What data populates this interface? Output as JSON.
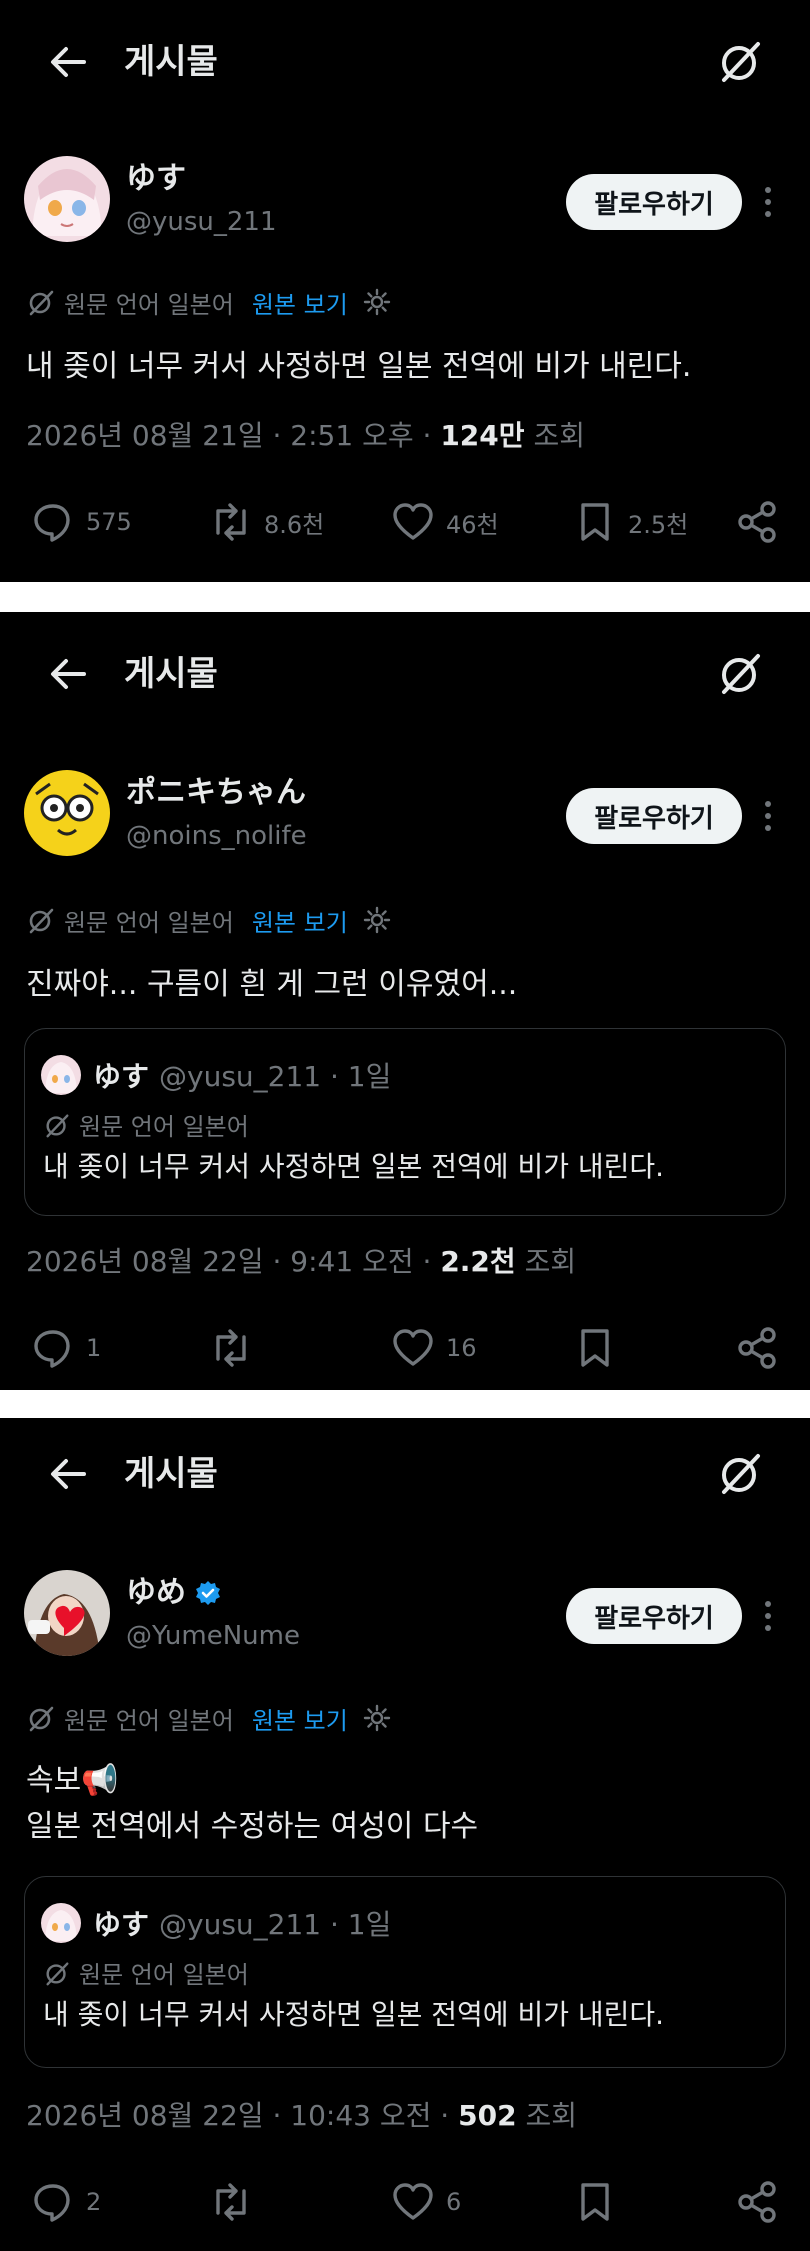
{
  "colors": {
    "background": "#000000",
    "text": "#e7e9ea",
    "muted": "#71767b",
    "link": "#1d9bf0",
    "verified": "#1d9bf0"
  },
  "icons": {
    "back": "arrow-left-icon",
    "grok": "grok-icon",
    "more": "more-vertical-icon",
    "translate": "grok-small-icon",
    "settings": "gear-icon",
    "reply": "reply-icon",
    "repost": "repost-icon",
    "like": "heart-icon",
    "bookmark": "bookmark-icon",
    "share": "share-icon",
    "verified": "verified-badge-icon",
    "megaphone": "megaphone-emoji"
  },
  "posts": [
    {
      "header_title": "게시물",
      "author_name": "ゆす",
      "author_handle": "@yusu_211",
      "follow_label": "팔로우하기",
      "translate_label": "원문 언어 일본어",
      "show_original": "원본 보기",
      "text": "내 좆이 너무 커서 사정하면 일본 전역에 비가 내린다.",
      "timestamp": "2026년 08월 21일 · 2:51 오후 ·",
      "views_count": "124만",
      "views_label": "조회",
      "replies": "575",
      "reposts": "8.6천",
      "likes": "46천",
      "bookmarks": "2.5천"
    },
    {
      "header_title": "게시물",
      "author_name": "ポニキちゃん",
      "author_handle": "@noins_nolife",
      "follow_label": "팔로우하기",
      "translate_label": "원문 언어 일본어",
      "show_original": "원본 보기",
      "text": "진짜야... 구름이 흰 게 그런 이유였어...",
      "quote": {
        "name": "ゆす",
        "handle_time": "@yusu_211 · 1일",
        "translate_label": "원문 언어 일본어",
        "text": "내 좆이 너무 커서 사정하면 일본 전역에 비가 내린다."
      },
      "timestamp": "2026년 08월 22일 · 9:41 오전 ·",
      "views_count": "2.2천",
      "views_label": "조회",
      "replies": "1",
      "reposts": "",
      "likes": "16",
      "bookmarks": ""
    },
    {
      "header_title": "게시물",
      "author_name": "ゆめ",
      "author_handle": "@YumeNume",
      "follow_label": "팔로우하기",
      "translate_label": "원문 언어 일본어",
      "show_original": "원본 보기",
      "text_line1": "속보📢",
      "text_line2": "일본 전역에서 수정하는 여성이 다수",
      "quote": {
        "name": "ゆす",
        "handle_time": "@yusu_211 · 1일",
        "translate_label": "원문 언어 일본어",
        "text": "내 좆이 너무 커서 사정하면 일본 전역에 비가 내린다."
      },
      "timestamp": "2026년 08월 22일 · 10:43 오전 ·",
      "views_count": "502",
      "views_label": "조회",
      "replies": "2",
      "reposts": "",
      "likes": "6",
      "bookmarks": ""
    }
  ]
}
